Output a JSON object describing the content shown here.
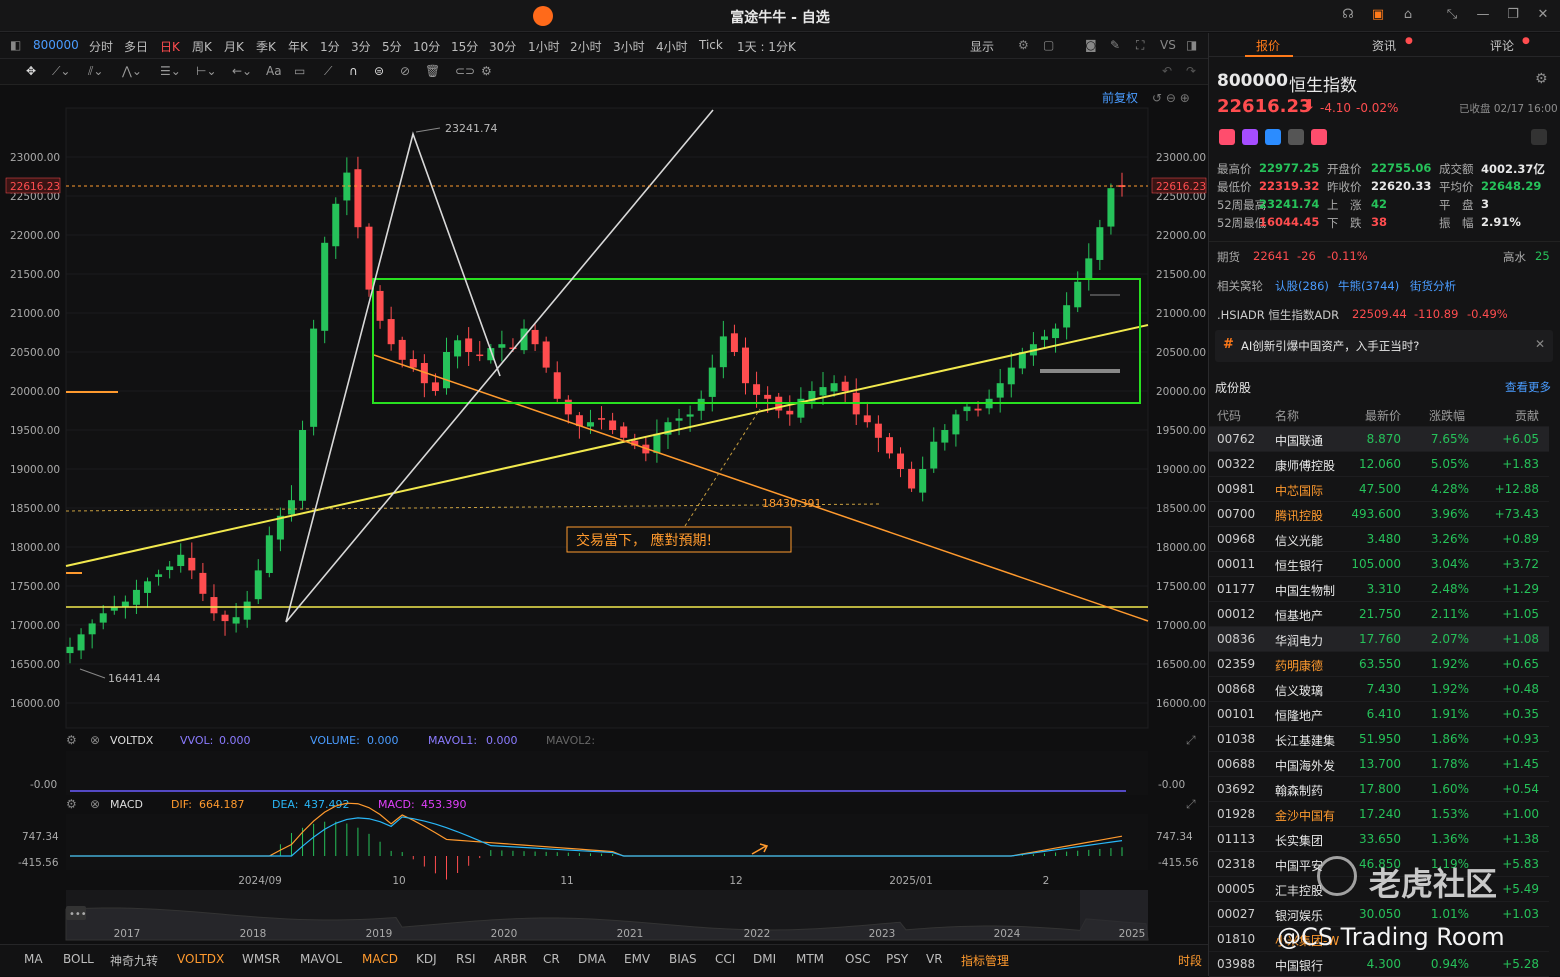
{
  "window": {
    "title": "富途牛牛 - 自选"
  },
  "timeframes": {
    "code": "800000",
    "items": [
      "分时",
      "多日",
      "日K",
      "周K",
      "月K",
      "季K",
      "年K",
      "1分",
      "3分",
      "5分",
      "10分",
      "15分",
      "30分",
      "1小时",
      "2小时",
      "3小时",
      "4小时",
      "Tick",
      "1天 : 1分K"
    ],
    "display_label": "显示"
  },
  "draw_tools": {
    "restore_label": "前复权"
  },
  "chart": {
    "price_axis": [
      "23000.00",
      "22500.00",
      "22000.00",
      "21500.00",
      "21000.00",
      "20500.00",
      "20000.00",
      "19500.00",
      "19000.00",
      "18500.00",
      "18000.00",
      "17500.00",
      "17000.00",
      "16500.00",
      "16000.00"
    ],
    "current_price_tag": "22616.23",
    "high_label": "23241.74",
    "low_label": "16441.44",
    "level_label": "18430.391",
    "annotation": "交易當下， 應對預期!",
    "date_axis": [
      "2024/09",
      "10",
      "11",
      "12",
      "2025/01",
      "2"
    ],
    "mini_axis": [
      "2017",
      "2018",
      "2019",
      "2020",
      "2021",
      "2022",
      "2023",
      "2024",
      "2025"
    ],
    "colors": {
      "up": "#26c25a",
      "down": "#ff4d4f",
      "yellow": "#f2e94e",
      "orange": "#ff9a2e",
      "box": "#28e020",
      "white": "#d9d9d9"
    },
    "voltdx": {
      "name": "VOLTDX",
      "vvol_label": "VVOL:",
      "vvol": "0.000",
      "volume_label": "VOLUME:",
      "volume": "0.000",
      "mavol1_label": "MAVOL1:",
      "mavol1": "0.000",
      "mavol2_label": "MAVOL2:",
      "axis": "-0.00"
    },
    "macd": {
      "name": "MACD",
      "dif_label": "DIF:",
      "dif": "664.187",
      "dea_label": "DEA:",
      "dea": "437.492",
      "macd_label": "MACD:",
      "macd": "453.390",
      "axis_top": "747.34",
      "axis_bot": "-415.56"
    }
  },
  "chart_data": {
    "type": "candlestick",
    "title": "800000 恒生指数",
    "ylim": [
      15750,
      23400
    ],
    "x": [
      "2024/09",
      "10",
      "11",
      "12",
      "2025/01",
      "2"
    ],
    "key_levels": {
      "high": 23241.74,
      "low": 16441.44,
      "current": 22616.23,
      "dotted": 18430.391
    },
    "close_series": [
      16720,
      16880,
      17020,
      17150,
      17230,
      17300,
      17450,
      17560,
      17650,
      17750,
      17900,
      17700,
      17400,
      17150,
      17050,
      17100,
      17300,
      17700,
      18150,
      18400,
      18600,
      19500,
      20800,
      21900,
      22400,
      22800,
      22100,
      21300,
      20900,
      20600,
      20400,
      20300,
      20100,
      20000,
      20500,
      20650,
      20500,
      20450,
      20550,
      20600,
      20550,
      20800,
      20600,
      20300,
      19900,
      19700,
      19550,
      19600,
      19650,
      19500,
      19400,
      19300,
      19200,
      19450,
      19600,
      19650,
      19700,
      19900,
      20300,
      20700,
      20500,
      20100,
      19950,
      19900,
      19750,
      19700,
      19900,
      20000,
      20050,
      20100,
      20000,
      19700,
      19600,
      19400,
      19200,
      19000,
      18750,
      19000,
      19350,
      19500,
      19700,
      19800,
      19750,
      19900,
      20100,
      20300,
      20500,
      20600,
      20700,
      20800,
      21100,
      21400,
      21700,
      22100,
      22600,
      22616
    ]
  },
  "sidebar": {
    "tabs": [
      "报价",
      "资讯",
      "评论"
    ],
    "code": "800000",
    "name": "恒生指数",
    "price": "22616.23",
    "arrow": "⬇",
    "change": "-4.10",
    "change_pct": "-0.02%",
    "status": "已收盘 02/17 16:00",
    "quote": [
      {
        "l": "最高价",
        "v": "22977.25",
        "c": "green"
      },
      {
        "l": "开盘价",
        "v": "22755.06",
        "c": "green"
      },
      {
        "l": "成交额",
        "v": "4002.37亿",
        "c": "white"
      },
      {
        "l": "最低价",
        "v": "22319.32",
        "c": "red"
      },
      {
        "l": "昨收价",
        "v": "22620.33",
        "c": "white"
      },
      {
        "l": "平均价",
        "v": "22648.29",
        "c": "green"
      },
      {
        "l": "52周最高",
        "v": "23241.74",
        "c": "green"
      },
      {
        "l": "上　涨",
        "v": "42",
        "c": "green"
      },
      {
        "l": "平　盘",
        "v": "3",
        "c": "white"
      },
      {
        "l": "52周最低",
        "v": "16044.45",
        "c": "red"
      },
      {
        "l": "下　跌",
        "v": "38",
        "c": "red"
      },
      {
        "l": "振　幅",
        "v": "2.91%",
        "c": "white"
      }
    ],
    "futures_label": "期货",
    "futures_price": "22641",
    "futures_chg": "-26",
    "futures_pct": "-0.11%",
    "futures_note": "高水",
    "futures_note_val": "25",
    "related_label": "相关窝轮",
    "warrants": "认股(286)",
    "bulls": "牛熊(3744)",
    "street": "街货分析",
    "adr_name": ".HSIADR 恒生指数ADR",
    "adr_price": "22509.44",
    "adr_chg": "-110.89",
    "adr_pct": "-0.49%",
    "promo": "AI创新引爆中国资产，入手正当时?",
    "components_title": "成份股",
    "see_more": "查看更多",
    "headers": [
      "代码",
      "名称",
      "最新价",
      "涨跌幅",
      "贡献"
    ],
    "rows": [
      {
        "code": "00762",
        "name": "中国联通",
        "price": "8.870",
        "pct": "7.65%",
        "contrib": "+6.05",
        "nc": "white"
      },
      {
        "code": "00322",
        "name": "康师傅控股",
        "price": "12.060",
        "pct": "5.05%",
        "contrib": "+1.83",
        "nc": "white"
      },
      {
        "code": "00981",
        "name": "中芯国际",
        "price": "47.500",
        "pct": "4.28%",
        "contrib": "+12.88",
        "nc": "org"
      },
      {
        "code": "00700",
        "name": "腾讯控股",
        "price": "493.600",
        "pct": "3.96%",
        "contrib": "+73.43",
        "nc": "org"
      },
      {
        "code": "00968",
        "name": "信义光能",
        "price": "3.480",
        "pct": "3.26%",
        "contrib": "+0.89",
        "nc": "white"
      },
      {
        "code": "00011",
        "name": "恒生银行",
        "price": "105.000",
        "pct": "3.04%",
        "contrib": "+3.72",
        "nc": "white"
      },
      {
        "code": "01177",
        "name": "中国生物制",
        "price": "3.310",
        "pct": "2.48%",
        "contrib": "+1.29",
        "nc": "white"
      },
      {
        "code": "00012",
        "name": "恒基地产",
        "price": "21.750",
        "pct": "2.11%",
        "contrib": "+1.05",
        "nc": "white"
      },
      {
        "code": "00836",
        "name": "华润电力",
        "price": "17.760",
        "pct": "2.07%",
        "contrib": "+1.08",
        "nc": "white"
      },
      {
        "code": "02359",
        "name": "药明康德",
        "price": "63.550",
        "pct": "1.92%",
        "contrib": "+0.65",
        "nc": "org"
      },
      {
        "code": "00868",
        "name": "信义玻璃",
        "price": "7.430",
        "pct": "1.92%",
        "contrib": "+0.48",
        "nc": "white"
      },
      {
        "code": "00101",
        "name": "恒隆地产",
        "price": "6.410",
        "pct": "1.91%",
        "contrib": "+0.35",
        "nc": "white"
      },
      {
        "code": "01038",
        "name": "长江基建集",
        "price": "51.950",
        "pct": "1.86%",
        "contrib": "+0.93",
        "nc": "white"
      },
      {
        "code": "00688",
        "name": "中国海外发",
        "price": "13.700",
        "pct": "1.78%",
        "contrib": "+1.45",
        "nc": "white"
      },
      {
        "code": "03692",
        "name": "翰森制药",
        "price": "17.800",
        "pct": "1.60%",
        "contrib": "+0.54",
        "nc": "white"
      },
      {
        "code": "01928",
        "name": "金沙中国有",
        "price": "17.240",
        "pct": "1.53%",
        "contrib": "+1.00",
        "nc": "org"
      },
      {
        "code": "01113",
        "name": "长实集团",
        "price": "33.650",
        "pct": "1.36%",
        "contrib": "+1.38",
        "nc": "white"
      },
      {
        "code": "02318",
        "name": "中国平安",
        "price": "46.850",
        "pct": "1.19%",
        "contrib": "+5.83",
        "nc": "white"
      },
      {
        "code": "00005",
        "name": "汇丰控股",
        "price": "",
        "pct": "",
        "contrib": "+5.49",
        "nc": "white"
      },
      {
        "code": "00027",
        "name": "银河娱乐",
        "price": "30.050",
        "pct": "1.01%",
        "contrib": "+1.03",
        "nc": "white"
      },
      {
        "code": "01810",
        "name": "小米集团-W",
        "price": "",
        "pct": "",
        "contrib": "",
        "nc": "org"
      },
      {
        "code": "03988",
        "name": "中国银行",
        "price": "4.300",
        "pct": "0.94%",
        "contrib": "+5.28",
        "nc": "white"
      }
    ]
  },
  "indicators": [
    "MA",
    "BOLL",
    "神奇九转",
    "VOLTDX",
    "WMSR",
    "MAVOL",
    "MACD",
    "KDJ",
    "RSI",
    "ARBR",
    "CR",
    "DMA",
    "EMV",
    "BIAS",
    "CCI",
    "DMI",
    "MTM",
    "OSC",
    "PSY",
    "VR",
    "指标管理"
  ],
  "indicators_right": "时段",
  "watermark": {
    "brand": "老虎社区",
    "handle": "@CS Trading Room"
  }
}
